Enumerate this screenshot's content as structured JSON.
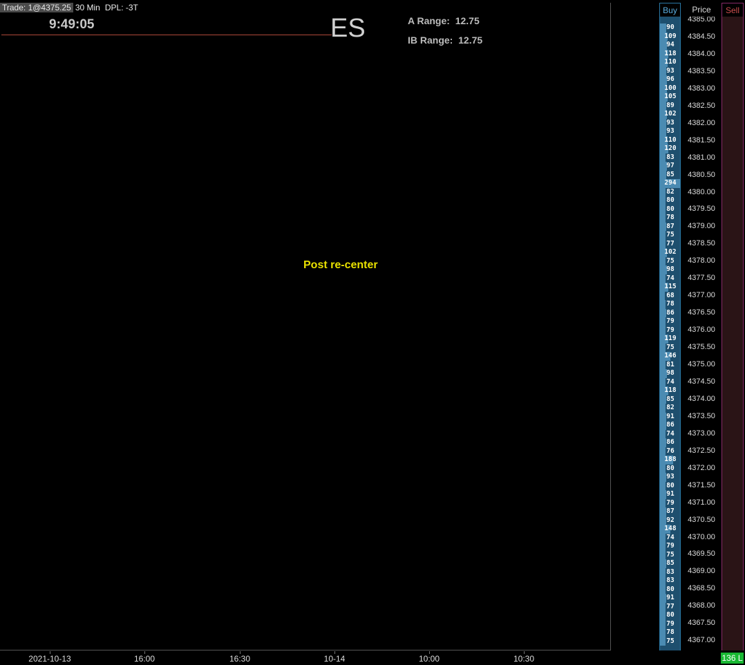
{
  "header": {
    "trade": "Trade: 1@4375.25",
    "interval": "30 Min",
    "dpl": "DPL: -3T"
  },
  "clock": "9:49:05",
  "symbol": "ES",
  "ranges": {
    "a_range": "A Range:  12.75",
    "ib_range": "IB Range:  12.75"
  },
  "note": "Post re-center",
  "xaxis": {
    "ticks": [
      "2021-10-13",
      "16:00",
      "16:30",
      "10-14",
      "10:00",
      "10:30"
    ]
  },
  "ladder": {
    "buy_label": "Buy",
    "price_label": "Price",
    "sell_label": "Sell",
    "buy_volumes": [
      90,
      109,
      94,
      118,
      110,
      93,
      96,
      100,
      105,
      89,
      102,
      93,
      93,
      110,
      120,
      83,
      97,
      85,
      294,
      82,
      80,
      80,
      78,
      87,
      75,
      77,
      102,
      75,
      98,
      74,
      115,
      68,
      78,
      86,
      79,
      79,
      119,
      75,
      146,
      81,
      98,
      74,
      118,
      85,
      82,
      91,
      86,
      74,
      86,
      76,
      188,
      80,
      93,
      80,
      91,
      79,
      87,
      92,
      148,
      74,
      79,
      75,
      85,
      83,
      83,
      80,
      91,
      77,
      80,
      79,
      78,
      75
    ],
    "prices": [
      "4385.00",
      "4384.50",
      "4384.00",
      "4383.50",
      "4383.00",
      "4382.50",
      "4382.00",
      "4381.50",
      "4381.00",
      "4380.50",
      "4380.00",
      "4379.50",
      "4379.00",
      "4378.50",
      "4378.00",
      "4377.50",
      "4377.00",
      "4376.50",
      "4376.00",
      "4375.50",
      "4375.00",
      "4374.50",
      "4374.00",
      "4373.50",
      "4373.00",
      "4372.50",
      "4372.00",
      "4371.50",
      "4371.00",
      "4370.50",
      "4370.00",
      "4369.50",
      "4369.00",
      "4368.50",
      "4368.00",
      "4367.50",
      "4367.00"
    ],
    "max_volume": 294
  },
  "status_badge": "136 L",
  "colors": {
    "buy_accent": "#4b8bb2",
    "sell_accent": "#d05050",
    "note_yellow": "#e8e000",
    "badge_green": "#19b833"
  }
}
